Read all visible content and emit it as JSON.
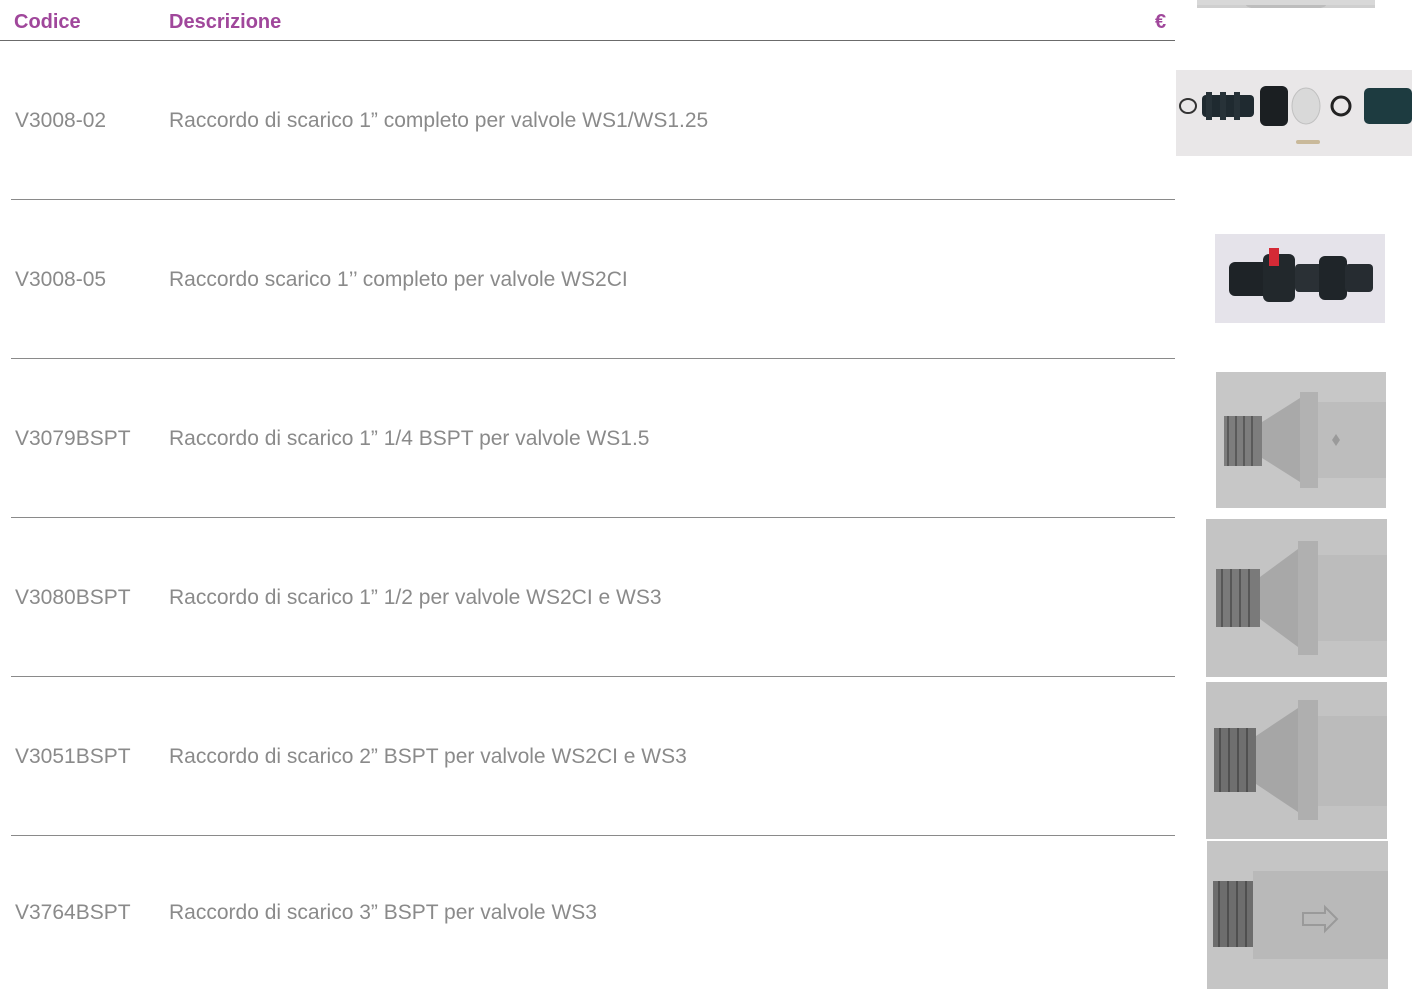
{
  "table": {
    "headers": {
      "code": "Codice",
      "description": "Descrizione",
      "price": "€"
    },
    "rows": [
      {
        "code": "V3008-02",
        "description": "Raccordo di scarico 1” completo per valvole WS1/WS1.25",
        "image": "drain-fitting-kit-photo"
      },
      {
        "code": "V3008-05",
        "description": "Raccordo scarico 1’’ completo per valvole WS2CI",
        "image": "drain-fitting-black-photo"
      },
      {
        "code": "V3079BSPT",
        "description": "Raccordo di scarico 1” 1/4 BSPT per valvole WS1.5",
        "image": "steel-drain-fitting-photo"
      },
      {
        "code": "V3080BSPT",
        "description": "Raccordo di scarico 1” 1/2 per valvole WS2CI e WS3",
        "image": "steel-drain-fitting-photo"
      },
      {
        "code": "V3051BSPT",
        "description": "Raccordo di scarico 2” BSPT per valvole WS2CI e WS3",
        "image": "steel-drain-fitting-photo"
      },
      {
        "code": "V3764BSPT",
        "description": "Raccordo di scarico 3” BSPT per valvole WS3",
        "image": "steel-drain-fitting-arrow-photo"
      }
    ]
  },
  "colors": {
    "header_accent": "#a0479b",
    "text": "#8a8a8a",
    "rule": "#8a8a8a"
  }
}
